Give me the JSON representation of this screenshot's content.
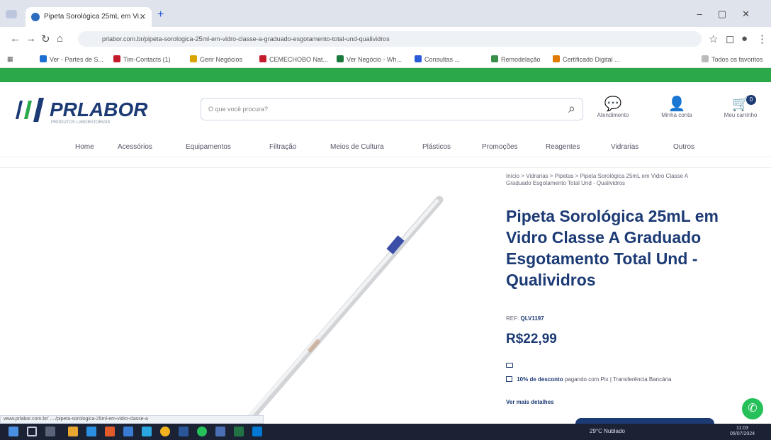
{
  "browser": {
    "tab_title": "Pipeta Sorológica 25mL em Vi...",
    "tab_close": "✕",
    "new_tab": "+",
    "address": "prlabor.com.br/pipeta-sorologica-25ml-em-vidro-classe-a-graduado-esgotamento-total-und-qualividros",
    "bookmarks": [
      "Ver - Partes de S...",
      "Tim-Contacts (1)",
      "Gerir Negócios",
      "CEMECHOBO Nat...",
      "Ver Negócio - Wh...",
      "Consultas ...",
      "Remodelação",
      "Certificado Digital ...",
      "Todos os favoritos"
    ],
    "status_url": "www.prlabor.com.br/ ... /pipeta-sorologica-25ml-em-vidro-classe-a"
  },
  "site": {
    "logo_text": "PRLABOR",
    "logo_tagline": "PRODUTOS LABORATORIAIS",
    "search_placeholder": "O que você procura?",
    "header_icons": [
      {
        "name": "atendimento",
        "label": "Atendimento",
        "glyph": "💬"
      },
      {
        "name": "account",
        "label": "Minha conta",
        "glyph": "👤"
      },
      {
        "name": "cart",
        "label": "Meu carrinho",
        "glyph": "🛒"
      }
    ],
    "cart_count": "0",
    "menu": [
      "Home",
      "Acessórios",
      "Equipamentos",
      "Filtração",
      "Meios de Cultura",
      "Plásticos",
      "Promoções",
      "Reagentes",
      "Vidrarias",
      "Outros"
    ]
  },
  "product": {
    "breadcrumb": "Início > Vidrarias > Pipetas > Pipeta Sorológica 25mL em Vidro Classe A Graduado Esgotamento Total Und - Qualividros",
    "title": "Pipeta Sorológica 25mL em Vidro Classe A Graduado Esgotamento Total Und - Qualividros",
    "ref_label": "REF:",
    "ref_value": "QLV1197",
    "price": "R$22,99",
    "pix_discount": "10% de desconto",
    "pix_text": "pagando com Pix | Transferência Bancária",
    "more_details": "Ver mais detalhes"
  },
  "taskbar": {
    "weather": "29°C Nublado",
    "time": "11:03",
    "date": "05/07/2024"
  },
  "colors": {
    "brand_navy": "#1c3a74",
    "brand_green": "#2aa84a",
    "whatsapp": "#25c05a"
  }
}
